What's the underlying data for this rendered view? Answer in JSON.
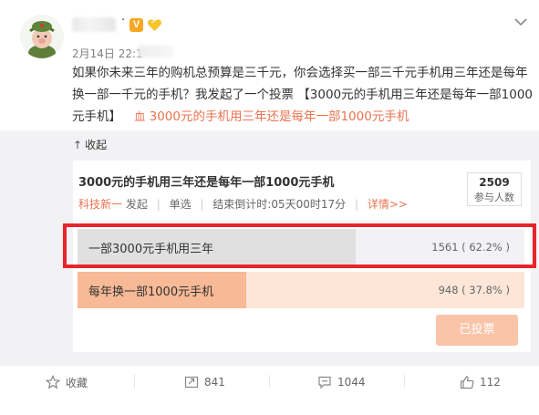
{
  "post": {
    "author_separator": "·",
    "verified_badge": "V",
    "time": "2月14日 22:1",
    "text_main": "如果你未来三年的购机总预算是三千元，你会选择买一部三千元手机用三年还是每年换一部一千元的手机？我发起了一个投票 【3000元的手机用三年还是每年一部1000元手机】",
    "link_icon": "血",
    "link_text": "3000元的手机用三年还是每年一部1000元手机"
  },
  "poll": {
    "collapse_label": "收起",
    "title": "3000元的手机用三年还是每年一部1000元手机",
    "author": "科技新一",
    "author_action": "发起",
    "mode": "单选",
    "countdown": "结束倒计时:05天00时17分",
    "details_link": "详情>>",
    "participants": "2509",
    "participants_label": "参与人数",
    "options": [
      {
        "label": "一部3000元手机用三年",
        "stat": "1561 ( 62.2% )",
        "fraction": 0.622
      },
      {
        "label": "每年换一部1000元手机",
        "stat": "948 ( 37.8% )",
        "fraction": 0.378
      }
    ],
    "voted_label": "已投票"
  },
  "footer": {
    "favorite": "收藏",
    "repost": "841",
    "comment": "1044",
    "like": "112"
  },
  "colors": {
    "accent": "#eb7350",
    "highlight": "#e8252b",
    "option_fill_selected": "#e0e0e0",
    "option_fill_other": "#f7b996"
  }
}
